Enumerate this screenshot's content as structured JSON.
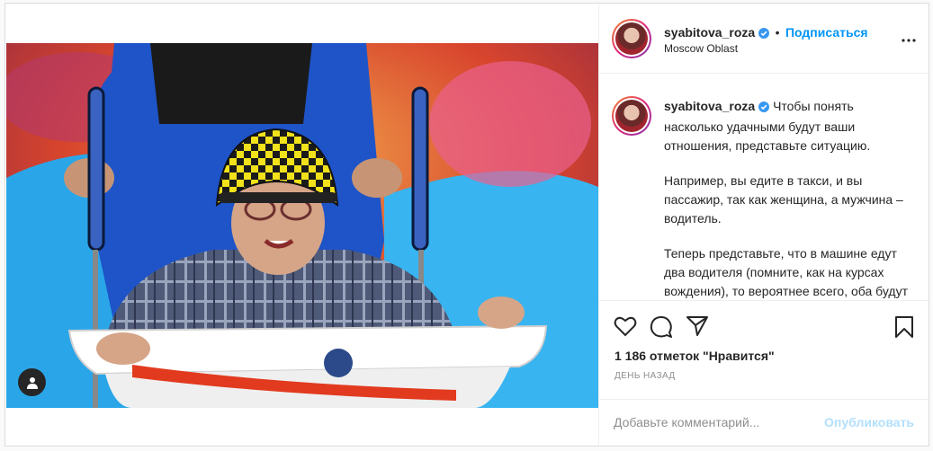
{
  "post": {
    "username": "syabitova_roza",
    "verified_icon": "verified-badge-icon",
    "dot": "•",
    "follow_label": "Подписаться",
    "location": "Moscow Oblast",
    "more_icon": "more-options-icon",
    "photo_alt": "Фото публикации",
    "user_tag_icon": "user-tag-icon"
  },
  "caption": {
    "username": "syabitova_roza",
    "paragraphs": [
      "Чтобы понять насколько удачными будут ваши отношения, представьте ситуацию.",
      "Например, вы едите в такси, и вы пассажир, так как женщина, а мужчина – водитель.",
      "Теперь представьте, что в машине едут два водителя (помните, как на курсах вождения), то вероятнее всего, оба будут хвататься за руль и"
    ]
  },
  "actions": {
    "like_icon": "heart-icon",
    "comment_icon": "comment-icon",
    "share_icon": "share-icon",
    "save_icon": "bookmark-icon",
    "likes_text": "1 186 отметок \"Нравится\"",
    "time_text": "день назад"
  },
  "comment_box": {
    "placeholder": "Добавьте комментарий...",
    "post_label": "Опубликовать"
  },
  "colors": {
    "accent": "#0095f6",
    "post_disabled": "#b2dffc",
    "border": "#dbdbdb"
  }
}
